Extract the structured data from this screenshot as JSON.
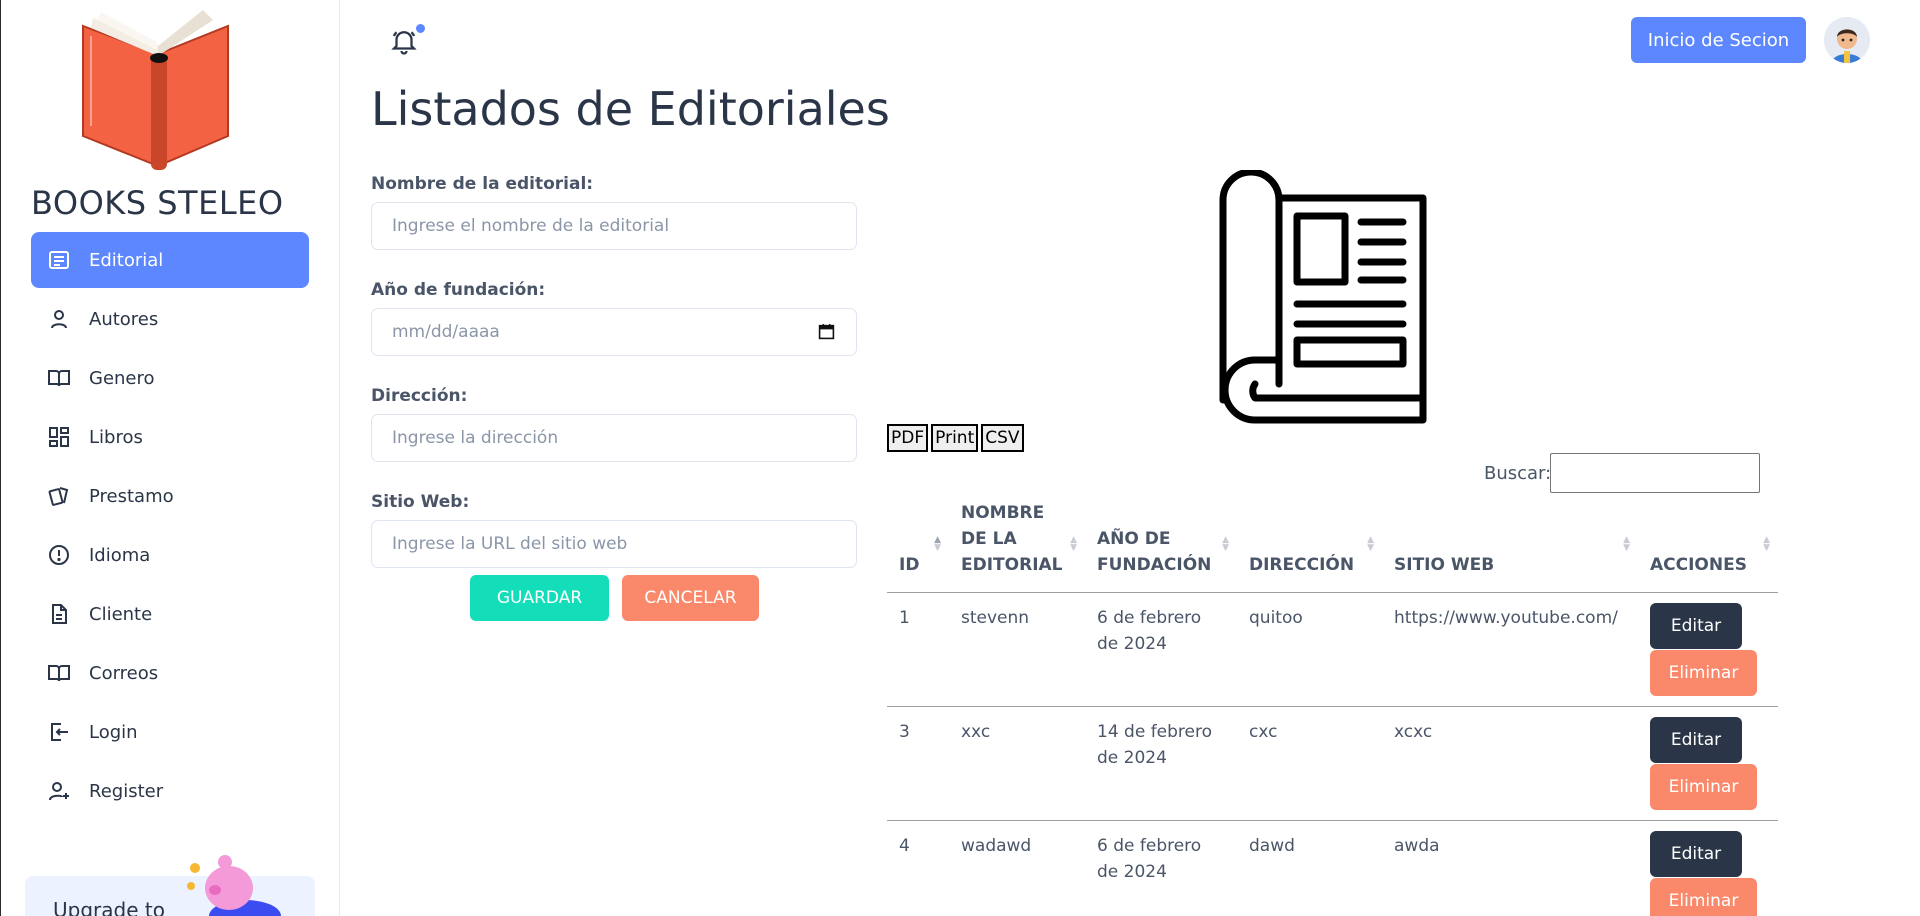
{
  "app": {
    "brand": "BOOKS STELEO"
  },
  "sidebar": {
    "items": [
      {
        "label": "Editorial",
        "icon": "list-icon",
        "active": true
      },
      {
        "label": "Autores",
        "icon": "user-icon"
      },
      {
        "label": "Genero",
        "icon": "book-open-icon"
      },
      {
        "label": "Libros",
        "icon": "dashboard-icon"
      },
      {
        "label": "Prestamo",
        "icon": "cards-icon"
      },
      {
        "label": "Idioma",
        "icon": "alert-circle-icon"
      },
      {
        "label": "Cliente",
        "icon": "file-icon"
      },
      {
        "label": "Correos",
        "icon": "book-open-icon"
      },
      {
        "label": "Login",
        "icon": "login-icon"
      },
      {
        "label": "Register",
        "icon": "user-plus-icon"
      }
    ],
    "upgrade_text": "Upgrade to"
  },
  "header": {
    "login_button": "Inicio de Secion"
  },
  "page": {
    "title": "Listados de Editoriales"
  },
  "form": {
    "name_label": "Nombre de la editorial:",
    "name_placeholder": "Ingrese el nombre de la editorial",
    "year_label": "Año de fundación:",
    "year_placeholder": "mm/dd/aaaa",
    "address_label": "Dirección:",
    "address_placeholder": "Ingrese la dirección",
    "web_label": "Sitio Web:",
    "web_placeholder": "Ingrese la URL del sitio web",
    "save_label": "GUARDAR",
    "cancel_label": "CANCELAR"
  },
  "table_tools": {
    "pdf": "PDF",
    "print": "Print",
    "csv": "CSV",
    "search_label": "Buscar:"
  },
  "table": {
    "headers": [
      "ID",
      "NOMBRE DE LA EDITORIAL",
      "AÑO DE FUNDACIÓN",
      "DIRECCIÓN",
      "SITIO WEB",
      "ACCIONES"
    ],
    "edit_label": "Editar",
    "delete_label": "Eliminar",
    "rows": [
      {
        "id": "1",
        "name": "stevenn",
        "year": "6 de febrero de 2024",
        "address": "quitoo",
        "web": "https://www.youtube.com/"
      },
      {
        "id": "3",
        "name": "xxc",
        "year": "14 de febrero de 2024",
        "address": "cxc",
        "web": "xcxc"
      },
      {
        "id": "4",
        "name": "wadawd",
        "year": "6 de febrero de 2024",
        "address": "dawd",
        "web": "awda"
      }
    ]
  },
  "colors": {
    "primary": "#5d87ff",
    "success": "#13deb9",
    "danger": "#fa896b",
    "dark": "#2a3547"
  }
}
